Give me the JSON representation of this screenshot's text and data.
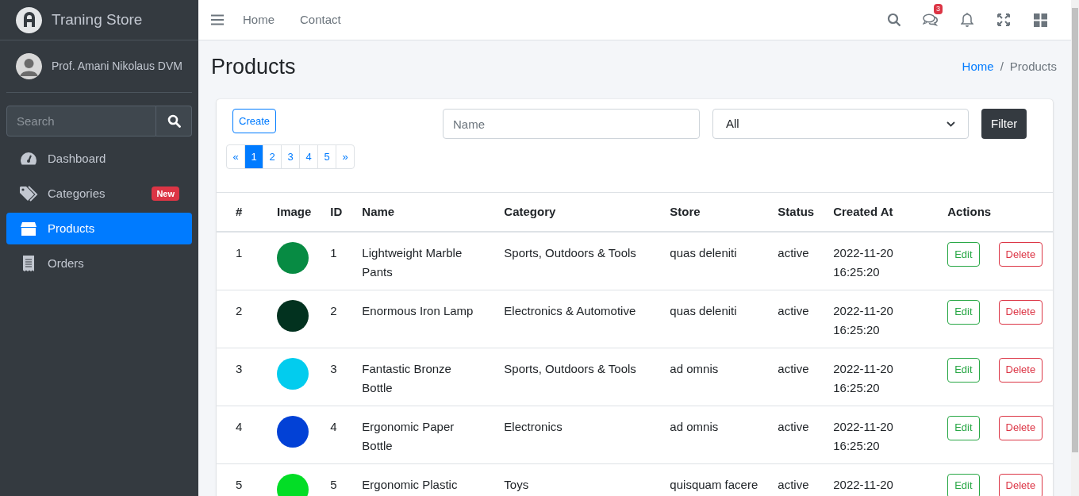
{
  "brand": {
    "name": "Traning Store"
  },
  "user": {
    "name": "Prof. Amani Nikolaus DVM"
  },
  "sidebar": {
    "search": {
      "placeholder": "Search"
    },
    "items": [
      {
        "kind": "gauge",
        "label": "Dashboard",
        "selected": false
      },
      {
        "kind": "tags",
        "label": "Categories",
        "badge": "New",
        "selected": false
      },
      {
        "kind": "box",
        "label": "Products",
        "selected": true
      },
      {
        "kind": "receipt",
        "label": "Orders",
        "selected": false
      }
    ]
  },
  "navbar": {
    "links": [
      "Home",
      "Contact"
    ],
    "messages_badge": "3"
  },
  "page": {
    "title": "Products",
    "breadcrumb": [
      {
        "label": "Home",
        "link": true
      },
      {
        "label": "Products",
        "link": false
      }
    ],
    "breadcrumb_separator": "/"
  },
  "toolbar": {
    "create": "Create",
    "name_field": {
      "placeholder": "Name"
    },
    "status_select": {
      "value": "All"
    },
    "filter": "Filter"
  },
  "pagination": [
    {
      "label": "«",
      "selected": false
    },
    {
      "label": "1",
      "selected": true
    },
    {
      "label": "2",
      "selected": false
    },
    {
      "label": "3",
      "selected": false
    },
    {
      "label": "4",
      "selected": false
    },
    {
      "label": "5",
      "selected": false
    },
    {
      "label": "»",
      "selected": false
    }
  ],
  "table": {
    "columns": [
      "#",
      "Image",
      "ID",
      "Name",
      "Category",
      "Store",
      "Status",
      "Created At",
      "Actions"
    ],
    "rows": [
      {
        "index": "1",
        "color": "#078b43",
        "id": "1",
        "name": "Lightweight Marble Pants",
        "category": "Sports, Outdoors & Tools",
        "store": "quas deleniti",
        "status": "active",
        "created_at": "2022-11-20 16:25:20",
        "edit": "Edit",
        "delete": "Delete"
      },
      {
        "index": "2",
        "color": "#02321f",
        "id": "2",
        "name": "Enormous Iron Lamp",
        "category": "Electronics & Automotive",
        "store": "quas deleniti",
        "status": "active",
        "created_at": "2022-11-20 16:25:20",
        "edit": "Edit",
        "delete": "Delete"
      },
      {
        "index": "3",
        "color": "#02ccee",
        "id": "3",
        "name": "Fantastic Bronze Bottle",
        "category": "Sports, Outdoors & Tools",
        "store": "ad omnis",
        "status": "active",
        "created_at": "2022-11-20 16:25:20",
        "edit": "Edit",
        "delete": "Delete"
      },
      {
        "index": "4",
        "color": "#0241d6",
        "id": "4",
        "name": "Ergonomic Paper Bottle",
        "category": "Electronics",
        "store": "ad omnis",
        "status": "active",
        "created_at": "2022-11-20 16:25:20",
        "edit": "Edit",
        "delete": "Delete"
      },
      {
        "index": "5",
        "color": "#03dd26",
        "id": "5",
        "name": "Ergonomic Plastic",
        "category": "Toys",
        "store": "quisquam facere",
        "status": "active",
        "created_at": "2022-11-20",
        "edit": "Edit",
        "delete": "Delete"
      }
    ]
  }
}
